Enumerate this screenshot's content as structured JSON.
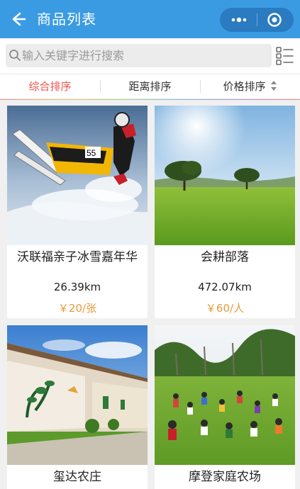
{
  "header": {
    "title": "商品列表",
    "back_icon": "arrow-left-icon",
    "more_icon": "more-dots-icon",
    "close_icon": "target-circle-icon",
    "bg_color": "#3a9be3"
  },
  "search": {
    "placeholder": "输入关键字进行搜索",
    "value": "",
    "icon": "search-icon",
    "list_toggle_icon": "list-view-icon"
  },
  "sort": {
    "tabs": [
      {
        "label": "综合排序",
        "active": true
      },
      {
        "label": "距离排序",
        "active": false
      },
      {
        "label": "价格排序",
        "active": false
      }
    ],
    "active_color": "#e8554e"
  },
  "products": [
    {
      "name": "沃联福亲子冰雪嘉年华",
      "distance": "26.39km",
      "price": "￥20/张",
      "image": "snowmobile-photo"
    },
    {
      "name": "会耕部落",
      "distance": "472.07km",
      "price": "￥60/人",
      "image": "grassland-trees-photo"
    },
    {
      "name": "玺达农庄",
      "image": "farm-wall-mural-photo"
    },
    {
      "name": "摩登家庭农场",
      "image": "kids-on-lawn-photo"
    }
  ],
  "price_color": "#e89a3a"
}
